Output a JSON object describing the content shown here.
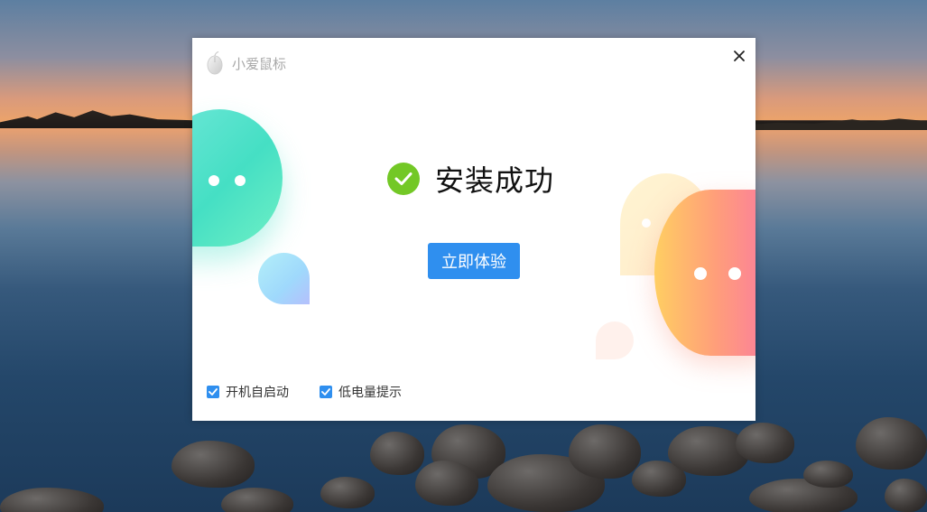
{
  "dialog": {
    "app_title": "小爱鼠标",
    "status_text": "安装成功",
    "primary_button": "立即体验",
    "options": [
      {
        "label": "开机自启动",
        "checked": true
      },
      {
        "label": "低电量提示",
        "checked": true
      }
    ]
  },
  "colors": {
    "accent": "#2f8fef",
    "success": "#73c826"
  },
  "icons": {
    "app": "mouse-icon",
    "close": "close-icon",
    "success": "checkmark-circle-icon",
    "checkbox": "checkbox-checked-icon"
  }
}
